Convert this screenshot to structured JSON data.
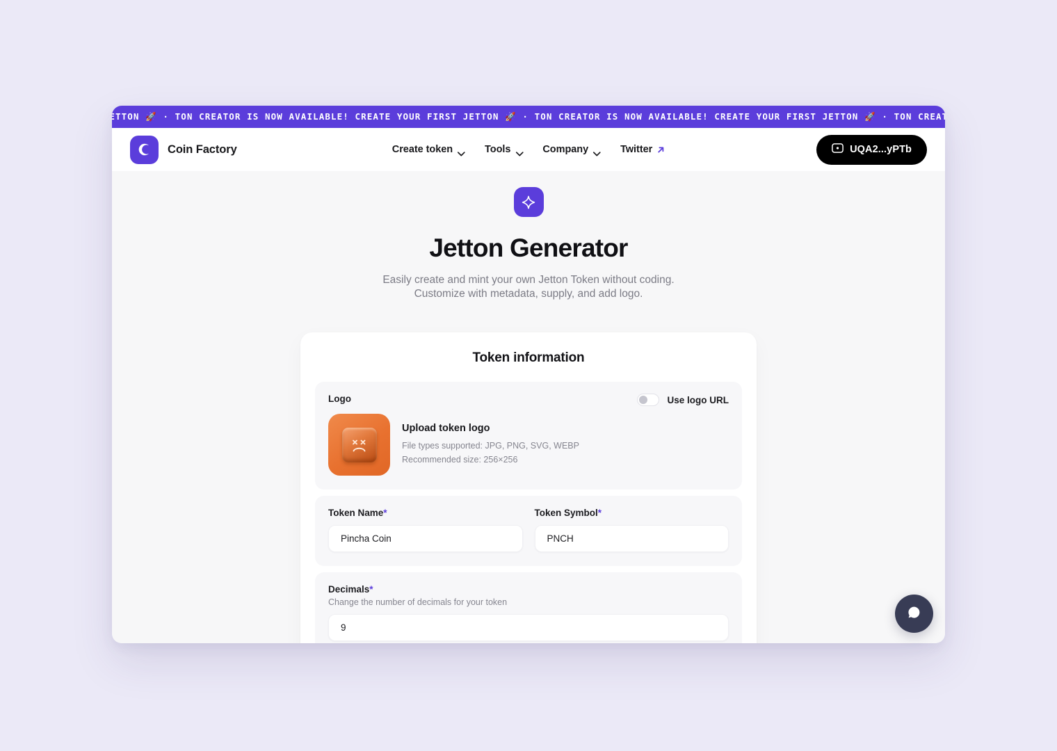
{
  "banner": {
    "text": "FIRST JETTON 🚀  ·  TON CREATOR IS NOW AVAILABLE! CREATE YOUR FIRST JETTON 🚀  ·  TON CREATOR IS NOW AVAILABLE! CREATE YOUR FIRST JETTON 🚀  ·  TON CREATOR IS NOW AVAILABLE! CREATE YOUR FIRST JETTON 🚀  ·  TON CREATOR IS NOW AV",
    "bg_color": "#5b3ddb",
    "text_color": "#ffffff"
  },
  "header": {
    "brand_name": "Coin Factory",
    "brand_icon": "letter-c-logo-icon",
    "nav": [
      {
        "label": "Create token",
        "icon": "chevron-down-icon",
        "has_dropdown": true
      },
      {
        "label": "Tools",
        "icon": "chevron-down-icon",
        "has_dropdown": true
      },
      {
        "label": "Company",
        "icon": "chevron-down-icon",
        "has_dropdown": true
      },
      {
        "label": "Twitter",
        "icon": "external-link-arrow-icon",
        "has_dropdown": false
      }
    ],
    "wallet": {
      "label": "UQA2...yPTb",
      "icon": "wallet-icon",
      "bg_color": "#000000"
    }
  },
  "hero": {
    "icon": "sparkle-icon",
    "icon_bg": "#5b3ddb",
    "title": "Jetton Generator",
    "subtitle": "Easily create and mint your own Jetton Token without coding. Customize with metadata, supply, and add logo."
  },
  "card": {
    "title": "Token information",
    "logo_section": {
      "label": "Logo",
      "toggle_label": "Use logo URL",
      "toggle_on": false,
      "thumb_icon": "sad-face-keycap-icon",
      "upload_title": "Upload token logo",
      "file_types": "File types supported: JPG, PNG, SVG, WEBP",
      "recommended_size": "Recommended size: 256×256"
    },
    "fields": {
      "token_name": {
        "label": "Token Name",
        "required_marker": "*",
        "value": "Pincha Coin",
        "placeholder": "Token Name"
      },
      "token_symbol": {
        "label": "Token Symbol",
        "required_marker": "*",
        "value": "PNCH",
        "placeholder": "Token Symbol"
      },
      "decimals": {
        "label": "Decimals",
        "required_marker": "*",
        "help": "Change the number of decimals for your token",
        "value": "9",
        "placeholder": "9"
      }
    }
  },
  "chat": {
    "icon": "chat-bubble-icon",
    "bg_color": "#383c55"
  }
}
